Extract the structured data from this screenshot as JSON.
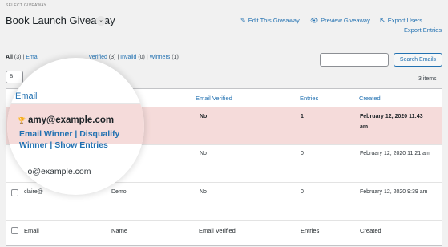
{
  "header": {
    "select_label": "SELECT GIVEAWAY",
    "title": "Book Launch Giveaway",
    "caret": "⌄"
  },
  "actions": {
    "edit": "Edit This Giveaway",
    "preview": "Preview Giveaway",
    "export_users": "Export Users",
    "export_entries": "Export Entries"
  },
  "filters": {
    "all": "All",
    "all_count": "(3)",
    "sep": "|",
    "email_frag": "Ema",
    "verified_frag": "Verified",
    "verified_count": "(3)",
    "invalid": "Invalid",
    "invalid_count": "(0)",
    "winners": "Winners",
    "winners_count": "(1)"
  },
  "search": {
    "button": "Search Emails",
    "value": ""
  },
  "bulk": {
    "label": "B"
  },
  "items_count": "3 items",
  "table": {
    "columns": {
      "email": "Email",
      "name": "Name",
      "verified": "Email Verified",
      "entries": "Entries",
      "created": "Created"
    },
    "rows": [
      {
        "verified": "No",
        "entries": "1",
        "created_1": "February 12, 2020 11:43",
        "created_2": "am"
      },
      {
        "verified": "No",
        "entries": "0",
        "created": "February 12, 2020 11:21 am"
      },
      {
        "email": "claire@",
        "name": "Demo",
        "verified": "No",
        "entries": "0",
        "created": "February 12, 2020 9:39 am"
      }
    ]
  },
  "magnifier": {
    "email_header": "Email",
    "email": "amy@example.com",
    "email_winner": "Email Winner",
    "sep": "|",
    "disqualify": "Disqualify",
    "winner": "Winner",
    "show_entries": "Show Entries",
    "next_email": "…o@example.com"
  }
}
